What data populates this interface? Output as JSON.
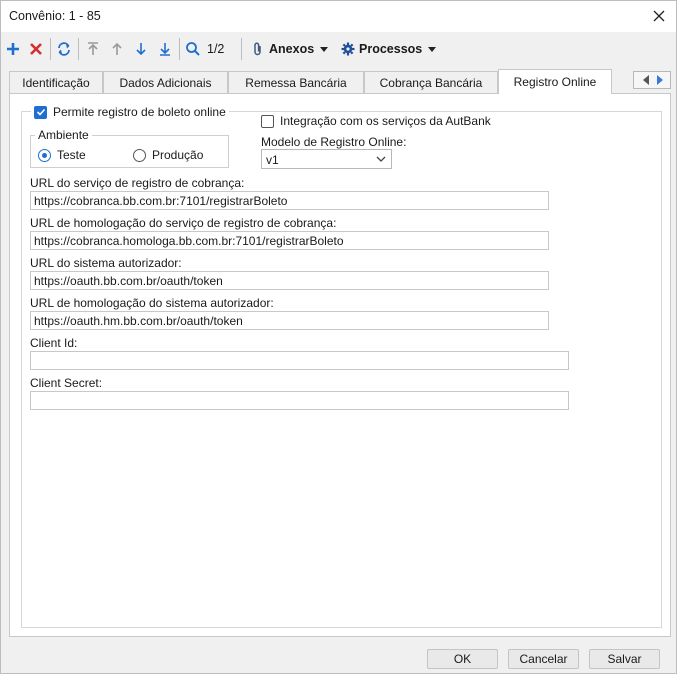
{
  "window": {
    "title": "Convênio: 1 - 85"
  },
  "toolbar": {
    "record_counter": "1/2",
    "anexos_label": "Anexos",
    "processos_label": "Processos"
  },
  "tabs": [
    {
      "label": "Identificação"
    },
    {
      "label": "Dados Adicionais"
    },
    {
      "label": "Remessa Bancária"
    },
    {
      "label": "Cobrança Bancária"
    },
    {
      "label": "Registro Online",
      "active": true
    }
  ],
  "form": {
    "permite_registro_label": "Permite registro de boleto online",
    "permite_registro_checked": true,
    "ambiente_label": "Ambiente",
    "ambiente_options": [
      {
        "label": "Teste",
        "selected": true
      },
      {
        "label": "Produção",
        "selected": false
      }
    ],
    "integracao_label": "Integração com os serviços da AutBank",
    "integracao_checked": false,
    "modelo_label": "Modelo de Registro Online:",
    "modelo_value": "v1",
    "fields": [
      {
        "label": "URL do serviço de registro de cobrança:",
        "value": "https://cobranca.bb.com.br:7101/registrarBoleto"
      },
      {
        "label": "URL de homologação do serviço de registro de cobrança:",
        "value": "https://cobranca.homologa.bb.com.br:7101/registrarBoleto"
      },
      {
        "label": "URL do sistema autorizador:",
        "value": "https://oauth.bb.com.br/oauth/token"
      },
      {
        "label": "URL de homologação do sistema autorizador:",
        "value": "https://oauth.hm.bb.com.br/oauth/token"
      },
      {
        "label": "Client Id:",
        "value": ""
      },
      {
        "label": "Client Secret:",
        "value": ""
      }
    ]
  },
  "buttons": {
    "ok": "OK",
    "cancel": "Cancelar",
    "save": "Salvar"
  },
  "colors": {
    "accent": "#1f6fd1",
    "add": "#1f6fd1",
    "delete": "#d32f2f"
  }
}
